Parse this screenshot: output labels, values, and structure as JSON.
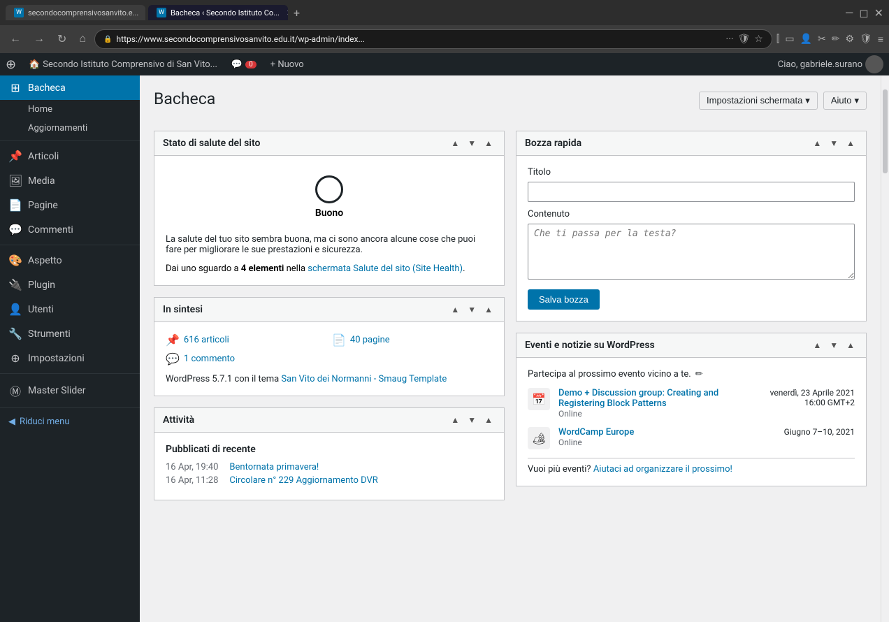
{
  "browser": {
    "tabs": [
      {
        "id": "tab1",
        "label": "secondocomprensivosanvito.e...",
        "active": false,
        "icon": "W"
      },
      {
        "id": "tab2",
        "label": "Bacheca ‹ Secondo Istituto Co...",
        "active": true,
        "icon": "W"
      }
    ],
    "address": "https://www.secondocomprensivosanvito.edu.it/wp-admin/index...",
    "new_tab_label": "+"
  },
  "admin_bar": {
    "wp_logo": "⊕",
    "site_name": "Secondo Istituto Comprensivo di San Vito...",
    "comment_count": "0",
    "new_label": "+ Nuovo",
    "user_label": "Ciao, gabriele.surano"
  },
  "sidebar": {
    "home_label": "Home",
    "updates_label": "Aggiornamenti",
    "items": [
      {
        "id": "bacheca",
        "label": "Bacheca",
        "icon": "⊞",
        "active": true
      },
      {
        "id": "articoli",
        "label": "Articoli",
        "icon": "📌"
      },
      {
        "id": "media",
        "label": "Media",
        "icon": "🖼"
      },
      {
        "id": "pagine",
        "label": "Pagine",
        "icon": "📄"
      },
      {
        "id": "commenti",
        "label": "Commenti",
        "icon": "💬"
      },
      {
        "id": "aspetto",
        "label": "Aspetto",
        "icon": "🎨"
      },
      {
        "id": "plugin",
        "label": "Plugin",
        "icon": "🔌"
      },
      {
        "id": "utenti",
        "label": "Utenti",
        "icon": "👤"
      },
      {
        "id": "strumenti",
        "label": "Strumenti",
        "icon": "🔧"
      },
      {
        "id": "impostazioni",
        "label": "Impostazioni",
        "icon": "⚙"
      },
      {
        "id": "master-slider",
        "label": "Master Slider",
        "icon": "Ⓜ"
      }
    ],
    "reduce_menu_label": "Riduci menu"
  },
  "content": {
    "page_title": "Bacheca",
    "screen_options_btn": "Impostazioni schermata",
    "help_btn": "Aiuto",
    "widgets": {
      "site_health": {
        "title": "Stato di salute del sito",
        "status": "Buono",
        "description": "La salute del tuo sito sembra buona, ma ci sono ancora alcune cose che puoi fare per migliorare le sue prestazioni e sicurezza.",
        "link_prefix": "Dai uno sguardo a ",
        "link_bold": "4 elementi",
        "link_mid": " nella ",
        "link_text": "schermata Salute del sito (Site Health)",
        "link_suffix": "."
      },
      "sintesi": {
        "title": "In sintesi",
        "articles_count": "616 articoli",
        "pages_count": "40 pagine",
        "comments_count": "1 commento",
        "wp_version": "WordPress 5.7.1 con il tema ",
        "theme_link": "San Vito dei Normanni - Smaug Template"
      },
      "bozza": {
        "title": "Bozza rapida",
        "title_label": "Titolo",
        "title_placeholder": "",
        "content_label": "Contenuto",
        "content_placeholder": "Che ti passa per la testa?",
        "save_btn": "Salva bozza"
      },
      "attivita": {
        "title": "Attività",
        "recently_published": "Pubblicati di recente",
        "posts": [
          {
            "date": "16 Apr, 19:40",
            "title": "Bentornata primavera!"
          },
          {
            "date": "16 Apr, 11:28",
            "title": "Circolare n° 229 Aggiornamento DVR"
          }
        ]
      },
      "events": {
        "title": "Eventi e notizie su WordPress",
        "intro": "Partecipa al prossimo evento vicino a te.",
        "items": [
          {
            "title": "Demo + Discussion group: Creating and Registering Block Patterns",
            "type": "Online",
            "date": "venerdì, 23 Aprile 2021",
            "time": "16:00 GMT+2"
          },
          {
            "title": "WordCamp Europe",
            "type": "Online",
            "date": "Giugno 7–10, 2021",
            "time": ""
          }
        ],
        "footer_prefix": "Vuoi più eventi? ",
        "footer_link": "Aiutaci ad organizzare il prossimo!"
      }
    }
  }
}
